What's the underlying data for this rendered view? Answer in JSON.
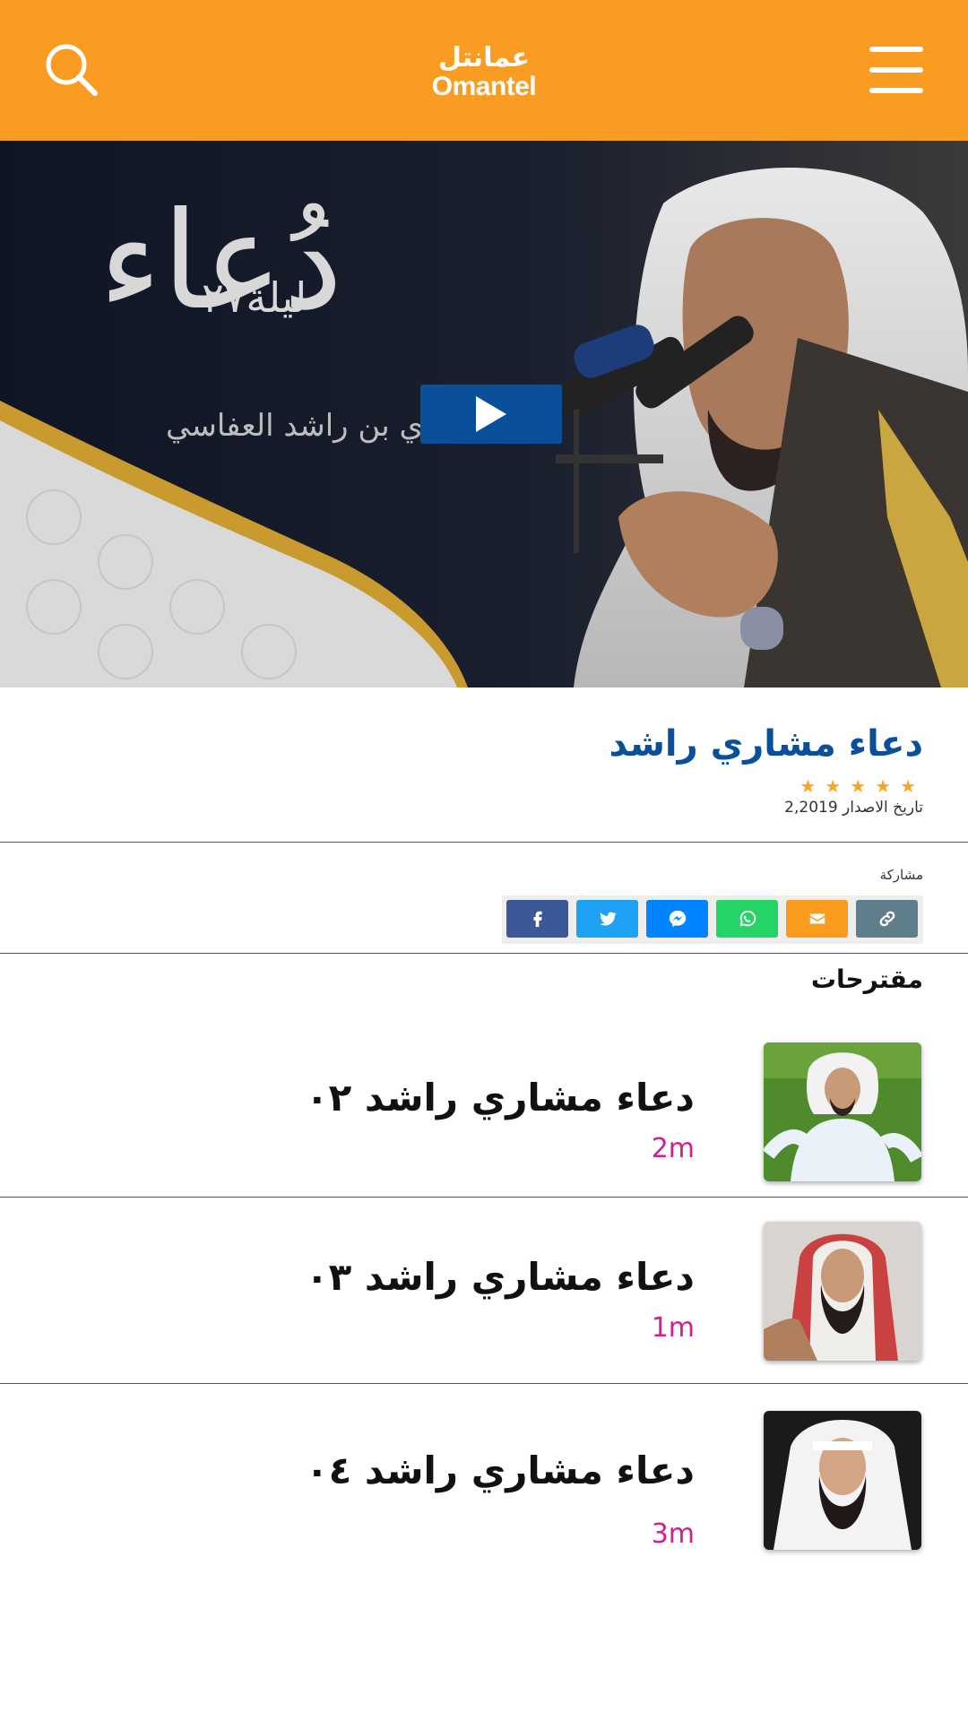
{
  "header": {
    "logo_ar": "عمانتل",
    "logo_en": "Omantel",
    "search_icon": "search-icon",
    "menu_icon": "hamburger-menu-icon",
    "background": "#fa9c22"
  },
  "hero": {
    "calligraphy_main": "دُعاء",
    "calligraphy_night": "ليلة٢٧",
    "calligraphy_name": "مشاري بن راشد العفاسي",
    "play_icon": "play-icon",
    "play_color": "#0a4f99"
  },
  "info": {
    "title": "دعاء مشاري راشد",
    "stars": "★★★★★",
    "release_label": "تاريخ الاصدار",
    "release_value": "2,2019",
    "title_color": "#0a4f99",
    "star_color": "#f6a623"
  },
  "share": {
    "label": "مشاركة",
    "buttons": [
      {
        "name": "facebook",
        "icon": "facebook-icon",
        "color": "#3b5998"
      },
      {
        "name": "twitter",
        "icon": "twitter-icon",
        "color": "#1da1f2"
      },
      {
        "name": "messenger",
        "icon": "messenger-icon",
        "color": "#0084ff"
      },
      {
        "name": "whatsapp",
        "icon": "whatsapp-icon",
        "color": "#25d366"
      },
      {
        "name": "email",
        "icon": "email-icon",
        "color": "#f99b1c"
      },
      {
        "name": "copy-link",
        "icon": "link-icon",
        "color": "#607d8b"
      }
    ]
  },
  "suggestions": {
    "title": "مقترحات",
    "duration_color": "#d0218a",
    "items": [
      {
        "name": "دعاء مشاري راشد ٠٢",
        "duration": "2m"
      },
      {
        "name": "دعاء مشاري راشد ٠٣",
        "duration": "1m"
      },
      {
        "name": "دعاء مشاري راشد ٠٤",
        "duration": "3m"
      }
    ]
  }
}
